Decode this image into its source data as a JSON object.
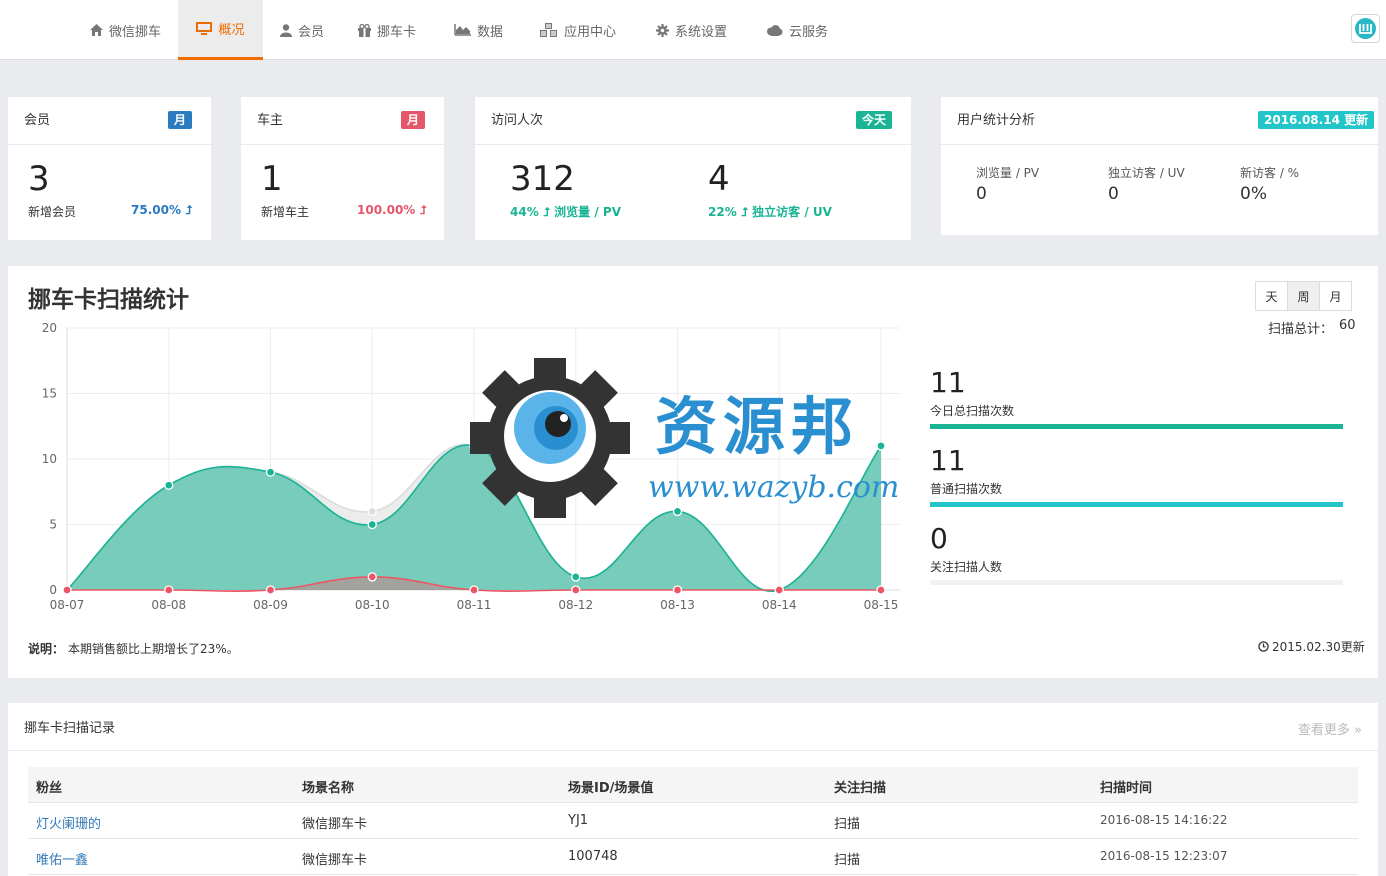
{
  "nav": {
    "items": [
      {
        "label": "微信挪车",
        "icon": "home-icon"
      },
      {
        "label": "概况",
        "icon": "monitor-icon"
      },
      {
        "label": "会员",
        "icon": "user-icon"
      },
      {
        "label": "挪车卡",
        "icon": "gift-icon"
      },
      {
        "label": "数据",
        "icon": "area-chart-icon"
      },
      {
        "label": "应用中心",
        "icon": "cubes-icon"
      },
      {
        "label": "系统设置",
        "icon": "gear-icon"
      },
      {
        "label": "云服务",
        "icon": "cloud-icon"
      }
    ],
    "active_index": 1,
    "accent": "#ef6c00"
  },
  "cards": {
    "member": {
      "title": "会员",
      "badge": "月",
      "badge_color": "#2a7bbf",
      "value": "3",
      "label": "新增会员",
      "pct": "75.00% ⮥",
      "pct_color": "#2a7bbf"
    },
    "owner": {
      "title": "车主",
      "badge": "月",
      "badge_color": "#e5566a",
      "value": "1",
      "label": "新增车主",
      "pct": "100.00% ⮥",
      "pct_color": "#e5566a"
    },
    "visits": {
      "title": "访问人次",
      "badge": "今天",
      "badge_color": "#1ab394",
      "pv_value": "312",
      "pv_pct": "44% ⮥ 浏览量 / PV",
      "uv_value": "4",
      "uv_pct": "22% ⮥ 独立访客 / UV",
      "pct_color": "#1ab394"
    },
    "analysis": {
      "title": "用户统计分析",
      "badge": "2016.08.14 更新",
      "badge_color": "#23c6c8",
      "stats": [
        {
          "label": "浏览量 / PV",
          "value": "0"
        },
        {
          "label": "独立访客 / UV",
          "value": "0"
        },
        {
          "label": "新访客 / %",
          "value": "0%"
        }
      ]
    }
  },
  "scan": {
    "title": "挪车卡扫描统计",
    "range_buttons": [
      "天",
      "周",
      "月"
    ],
    "active_range": 1,
    "total_label": "扫描总计：",
    "total_value": "60",
    "side_stats": [
      {
        "value": "11",
        "label": "今日总扫描次数",
        "fill": 1.0,
        "color": "#1ab394"
      },
      {
        "value": "11",
        "label": "普通扫描次数",
        "fill": 1.0,
        "color": "#23c6c8"
      },
      {
        "value": "0",
        "label": "关注扫描人数",
        "fill": 0.0,
        "color": "#1ab394"
      }
    ],
    "note_label": "说明：",
    "note_text": "本期销售额比上期增长了23%。",
    "updated": "2015.02.30更新"
  },
  "chart_data": {
    "type": "area",
    "categories": [
      "08-07",
      "08-08",
      "08-09",
      "08-10",
      "08-11",
      "08-12",
      "08-13",
      "08-14",
      "08-15"
    ],
    "ylim": [
      0,
      20
    ],
    "yticks": [
      0,
      5,
      10,
      15,
      20
    ],
    "grid": true,
    "series": [
      {
        "values": [
          0,
          8,
          9,
          6,
          11,
          1,
          6,
          0,
          11
        ],
        "color": "#dcdcdc"
      },
      {
        "values": [
          0,
          8,
          9,
          5,
          11,
          1,
          6,
          0,
          11
        ],
        "color": "#1ab394"
      },
      {
        "values": [
          0,
          0,
          0,
          1,
          0,
          0,
          0,
          0,
          0
        ],
        "color": "#ed5565"
      }
    ]
  },
  "watermark": {
    "cn": "资源邦",
    "url": "www.wazyb.com"
  },
  "records": {
    "title": "挪车卡扫描记录",
    "more": "查看更多 »",
    "columns": [
      "粉丝",
      "场景名称",
      "场景ID/场景值",
      "关注扫描",
      "扫描时间"
    ],
    "rows": [
      [
        "灯火阑珊的",
        "微信挪车卡",
        "YJ1",
        "扫描",
        "2016-08-15 14:16:22"
      ],
      [
        "唯佑一鑫",
        "微信挪车卡",
        "100748",
        "扫描",
        "2016-08-15 12:23:07"
      ]
    ]
  }
}
